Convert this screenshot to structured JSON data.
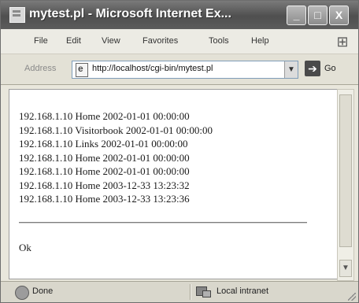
{
  "window": {
    "title": "mytest.pl - Microsoft Internet Ex...",
    "controls": {
      "minimize": "_",
      "maximize": "□",
      "close": "X"
    }
  },
  "menu": {
    "items": [
      {
        "label": "File"
      },
      {
        "label": "Edit"
      },
      {
        "label": "View"
      },
      {
        "label": "Favorites"
      },
      {
        "label": "Tools"
      },
      {
        "label": "Help"
      }
    ]
  },
  "address": {
    "label": "Address",
    "url": "http://localhost/cgi-bin/mytest.pl",
    "go_label": "Go"
  },
  "content": {
    "lines": [
      "192.168.1.10 Home 2002-01-01 00:00:00",
      "192.168.1.10 Visitorbook 2002-01-01 00:00:00",
      "192.168.1.10 Links 2002-01-01 00:00:00",
      "192.168.1.10 Home 2002-01-01 00:00:00",
      "192.168.1.10 Home 2002-01-01 00:00:00",
      "192.168.1.10 Home 2003-12-33 13:23:32",
      "192.168.1.10 Home 2003-12-33 13:23:36"
    ],
    "ok": "Ok"
  },
  "status": {
    "text": "Done",
    "zone": "Local intranet"
  },
  "icons": {
    "app": "ie-page-icon",
    "throbber": "windows-logo-icon",
    "address": "page-icon",
    "go": "go-arrow-icon",
    "status": "page-done-icon",
    "zone": "local-intranet-icon"
  }
}
